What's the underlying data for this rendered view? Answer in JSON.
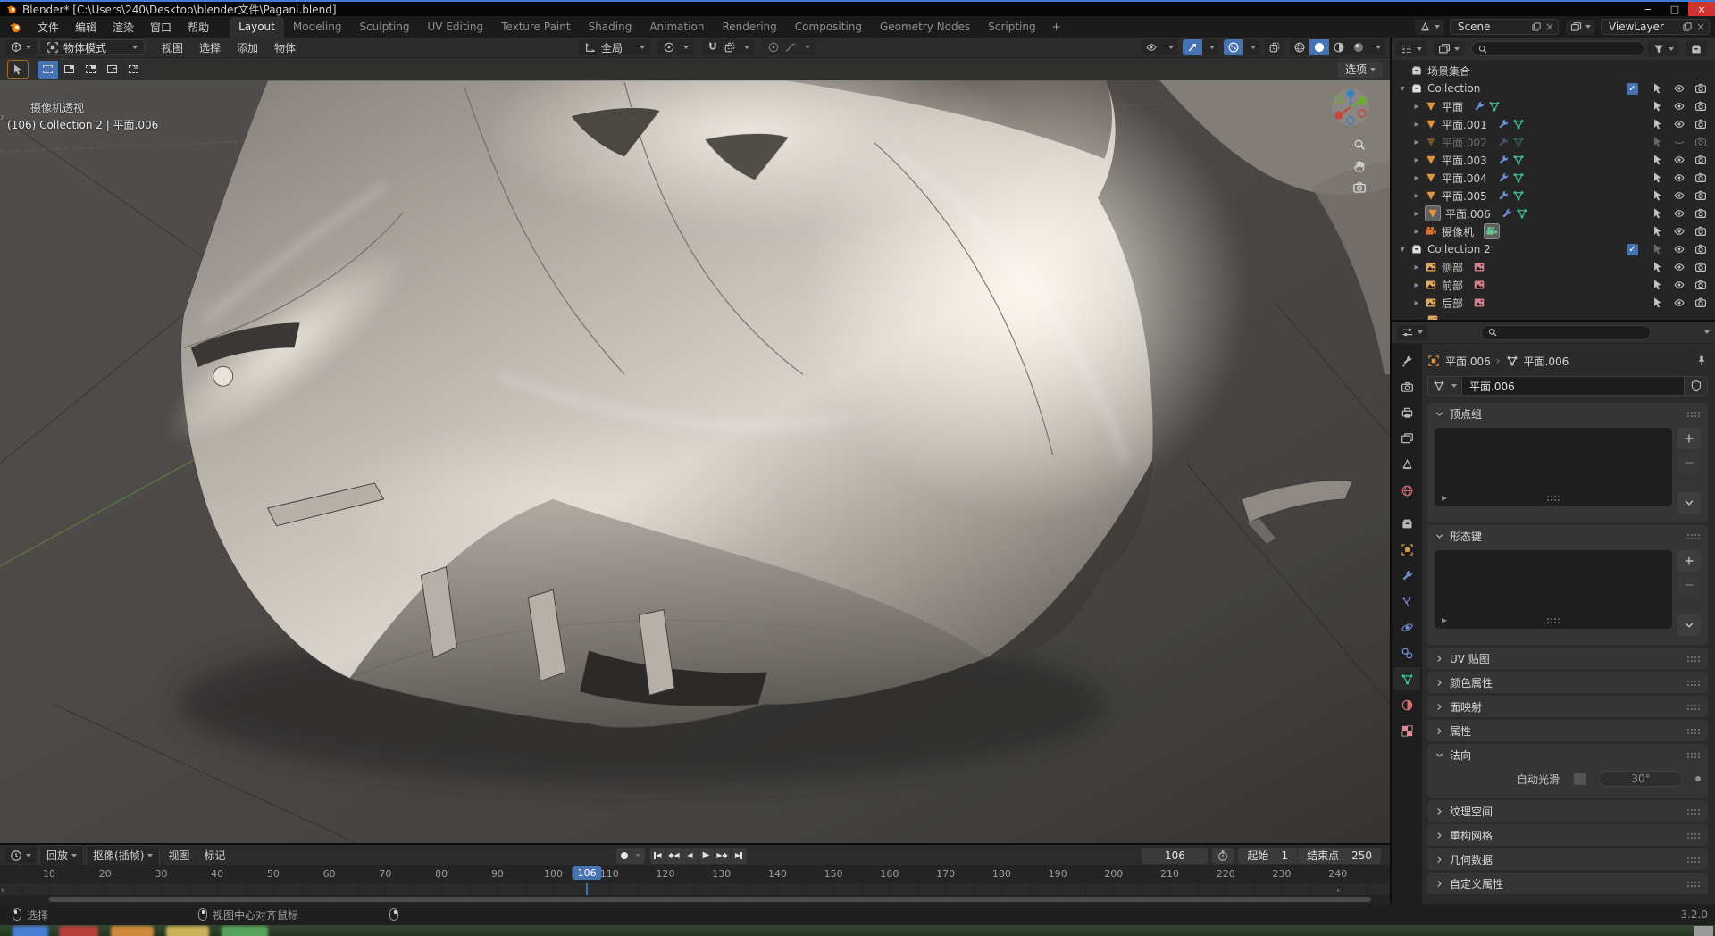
{
  "window": {
    "title": "Blender* [C:\\Users\\240\\Desktop\\blender文件\\Pagani.blend]",
    "controls": {
      "minimize": "−",
      "maximize": "□",
      "close": "×"
    }
  },
  "topbar": {
    "menus": [
      "文件",
      "编辑",
      "渲染",
      "窗口",
      "帮助"
    ],
    "workspaces": [
      "Layout",
      "Modeling",
      "Sculpting",
      "UV Editing",
      "Texture Paint",
      "Shading",
      "Animation",
      "Rendering",
      "Compositing",
      "Geometry Nodes",
      "Scripting"
    ],
    "active_workspace": "Layout",
    "add_workspace": "+",
    "scene": "Scene",
    "view_layer": "ViewLayer",
    "close_x": "×"
  },
  "viewport": {
    "mode": "物体模式",
    "menus": [
      "视图",
      "选择",
      "添加",
      "物体"
    ],
    "orientation": "全局",
    "options_label": "选项",
    "view_label": "摄像机透视",
    "context_label": "(106) Collection 2 | 平面.006",
    "edge_arrow": "›"
  },
  "outliner": {
    "search_placeholder": "",
    "rows": [
      {
        "label": "场景集合",
        "kind": "scene",
        "level": 0,
        "toggles": false
      },
      {
        "label": "Collection",
        "kind": "collection",
        "level": 0,
        "caret": "down",
        "checkbox": true
      },
      {
        "label": "平面",
        "kind": "mesh",
        "level": 1,
        "caret": "right"
      },
      {
        "label": "平面.001",
        "kind": "mesh",
        "level": 1,
        "caret": "right"
      },
      {
        "label": "平面.002",
        "kind": "mesh",
        "level": 1,
        "caret": "right",
        "dim": true,
        "eye": "closed"
      },
      {
        "label": "平面.003",
        "kind": "mesh",
        "level": 1,
        "caret": "right"
      },
      {
        "label": "平面.004",
        "kind": "mesh",
        "level": 1,
        "caret": "right"
      },
      {
        "label": "平面.005",
        "kind": "mesh",
        "level": 1,
        "caret": "right"
      },
      {
        "label": "平面.006",
        "kind": "mesh",
        "level": 1,
        "caret": "right",
        "selected": true
      },
      {
        "label": "摄像机",
        "kind": "camera",
        "level": 1,
        "caret": "right"
      },
      {
        "label": "Collection 2",
        "kind": "collection",
        "level": 0,
        "caret": "down",
        "checkbox": true,
        "sel_dim": true
      },
      {
        "label": "侧部",
        "kind": "image",
        "level": 1,
        "caret": "right"
      },
      {
        "label": "前部",
        "kind": "image",
        "level": 1,
        "caret": "right"
      },
      {
        "label": "后部",
        "kind": "image",
        "level": 1,
        "caret": "right"
      }
    ]
  },
  "properties": {
    "breadcrumb": [
      "平面.006",
      "平面.006"
    ],
    "name_field": "平面.006",
    "tabs": [
      {
        "id": "tool",
        "glyph": "i-tool",
        "color": "#b9b9b9"
      },
      {
        "id": "render",
        "glyph": "i-camrender",
        "color": "#b9b9b9"
      },
      {
        "id": "output",
        "glyph": "i-printer",
        "color": "#b9b9b9"
      },
      {
        "id": "view-layer",
        "glyph": "i-images",
        "color": "#b9b9b9"
      },
      {
        "id": "scene",
        "glyph": "i-cone",
        "color": "#b9b9b9"
      },
      {
        "id": "world",
        "glyph": "i-globe",
        "color": "#cf6a6a"
      },
      {
        "id": "collection",
        "glyph": "i-box",
        "color": "#b9b9b9",
        "gap": true
      },
      {
        "id": "object",
        "glyph": "i-square-obj",
        "color": "#dd9445"
      },
      {
        "id": "modifiers",
        "glyph": "i-wrench",
        "color": "#7090d5"
      },
      {
        "id": "particles",
        "glyph": "i-particles",
        "color": "#7090d5"
      },
      {
        "id": "physics",
        "glyph": "i-orbit",
        "color": "#7090d5"
      },
      {
        "id": "constraints",
        "glyph": "i-constraint",
        "color": "#7090d5"
      },
      {
        "id": "data",
        "glyph": "i-meshdata",
        "color": "#3ec58f",
        "active": true
      },
      {
        "id": "material",
        "glyph": "i-sphere-half",
        "color": "#d77070"
      },
      {
        "id": "texture",
        "glyph": "i-checker",
        "color": "#dd8d8d"
      }
    ],
    "panels": [
      {
        "label": "顶点组",
        "open": true,
        "body": "list"
      },
      {
        "label": "形态键",
        "open": true,
        "body": "list"
      },
      {
        "label": "UV 贴图"
      },
      {
        "label": "颜色属性"
      },
      {
        "label": "面映射"
      },
      {
        "label": "属性"
      },
      {
        "label": "法向",
        "open": true,
        "body": "normals"
      },
      {
        "label": "纹理空间"
      },
      {
        "label": "重构网格"
      },
      {
        "label": "几何数据"
      },
      {
        "label": "自定义属性"
      }
    ],
    "normals": {
      "auto_smooth_label": "自动光滑",
      "angle": "30°"
    }
  },
  "timeline": {
    "menus": [
      {
        "label": "回放",
        "dd": true,
        "boxed": true
      },
      {
        "label": "抠像(插帧)",
        "dd": true,
        "boxed": true
      },
      {
        "label": "视图",
        "dd": false
      },
      {
        "label": "标记",
        "dd": false
      }
    ],
    "ticks": [
      10,
      20,
      30,
      40,
      50,
      60,
      70,
      80,
      90,
      100,
      110,
      120,
      130,
      140,
      150,
      160,
      170,
      180,
      190,
      200,
      210,
      220,
      230,
      240
    ],
    "current_frame": 106,
    "frame_field": "106",
    "start_label": "起始",
    "start_value": "1",
    "end_label": "结束点",
    "end_value": "250",
    "edge_arrow": "›",
    "collapse_arrow": "‹"
  },
  "status": {
    "left_label": "选择",
    "middle_label": "视图中心对齐鼠标",
    "right_label": "",
    "version": "3.2.0"
  },
  "colors": {
    "accent": "#4772b3",
    "object_orange": "#e0933f",
    "mesh_green": "#3ec58f",
    "modifier_blue": "#6e8ed6",
    "image_pink": "#d9808f",
    "image_orange": "#e3a55b"
  }
}
